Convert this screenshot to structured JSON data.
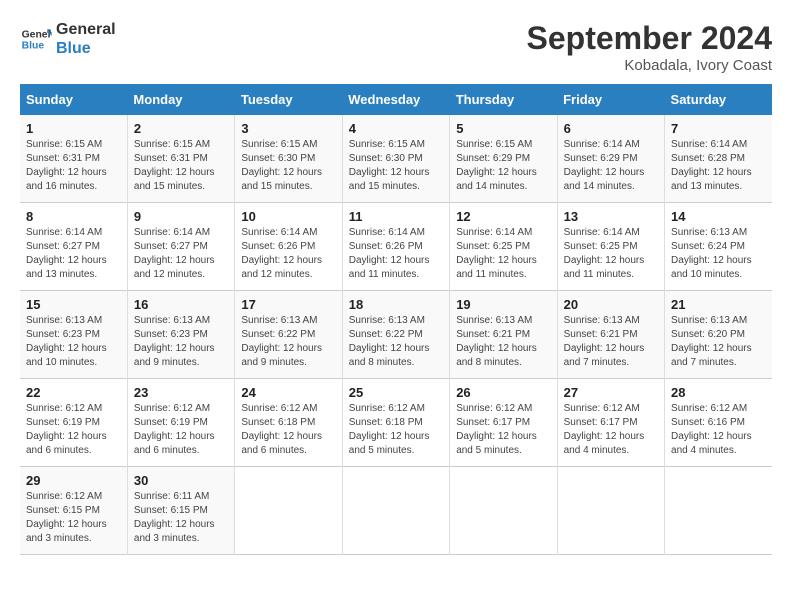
{
  "logo": {
    "line1": "General",
    "line2": "Blue"
  },
  "title": "September 2024",
  "location": "Kobadala, Ivory Coast",
  "days_of_week": [
    "Sunday",
    "Monday",
    "Tuesday",
    "Wednesday",
    "Thursday",
    "Friday",
    "Saturday"
  ],
  "weeks": [
    [
      {
        "day": "1",
        "info": "Sunrise: 6:15 AM\nSunset: 6:31 PM\nDaylight: 12 hours\nand 16 minutes."
      },
      {
        "day": "2",
        "info": "Sunrise: 6:15 AM\nSunset: 6:31 PM\nDaylight: 12 hours\nand 15 minutes."
      },
      {
        "day": "3",
        "info": "Sunrise: 6:15 AM\nSunset: 6:30 PM\nDaylight: 12 hours\nand 15 minutes."
      },
      {
        "day": "4",
        "info": "Sunrise: 6:15 AM\nSunset: 6:30 PM\nDaylight: 12 hours\nand 15 minutes."
      },
      {
        "day": "5",
        "info": "Sunrise: 6:15 AM\nSunset: 6:29 PM\nDaylight: 12 hours\nand 14 minutes."
      },
      {
        "day": "6",
        "info": "Sunrise: 6:14 AM\nSunset: 6:29 PM\nDaylight: 12 hours\nand 14 minutes."
      },
      {
        "day": "7",
        "info": "Sunrise: 6:14 AM\nSunset: 6:28 PM\nDaylight: 12 hours\nand 13 minutes."
      }
    ],
    [
      {
        "day": "8",
        "info": "Sunrise: 6:14 AM\nSunset: 6:27 PM\nDaylight: 12 hours\nand 13 minutes."
      },
      {
        "day": "9",
        "info": "Sunrise: 6:14 AM\nSunset: 6:27 PM\nDaylight: 12 hours\nand 12 minutes."
      },
      {
        "day": "10",
        "info": "Sunrise: 6:14 AM\nSunset: 6:26 PM\nDaylight: 12 hours\nand 12 minutes."
      },
      {
        "day": "11",
        "info": "Sunrise: 6:14 AM\nSunset: 6:26 PM\nDaylight: 12 hours\nand 11 minutes."
      },
      {
        "day": "12",
        "info": "Sunrise: 6:14 AM\nSunset: 6:25 PM\nDaylight: 12 hours\nand 11 minutes."
      },
      {
        "day": "13",
        "info": "Sunrise: 6:14 AM\nSunset: 6:25 PM\nDaylight: 12 hours\nand 11 minutes."
      },
      {
        "day": "14",
        "info": "Sunrise: 6:13 AM\nSunset: 6:24 PM\nDaylight: 12 hours\nand 10 minutes."
      }
    ],
    [
      {
        "day": "15",
        "info": "Sunrise: 6:13 AM\nSunset: 6:23 PM\nDaylight: 12 hours\nand 10 minutes."
      },
      {
        "day": "16",
        "info": "Sunrise: 6:13 AM\nSunset: 6:23 PM\nDaylight: 12 hours\nand 9 minutes."
      },
      {
        "day": "17",
        "info": "Sunrise: 6:13 AM\nSunset: 6:22 PM\nDaylight: 12 hours\nand 9 minutes."
      },
      {
        "day": "18",
        "info": "Sunrise: 6:13 AM\nSunset: 6:22 PM\nDaylight: 12 hours\nand 8 minutes."
      },
      {
        "day": "19",
        "info": "Sunrise: 6:13 AM\nSunset: 6:21 PM\nDaylight: 12 hours\nand 8 minutes."
      },
      {
        "day": "20",
        "info": "Sunrise: 6:13 AM\nSunset: 6:21 PM\nDaylight: 12 hours\nand 7 minutes."
      },
      {
        "day": "21",
        "info": "Sunrise: 6:13 AM\nSunset: 6:20 PM\nDaylight: 12 hours\nand 7 minutes."
      }
    ],
    [
      {
        "day": "22",
        "info": "Sunrise: 6:12 AM\nSunset: 6:19 PM\nDaylight: 12 hours\nand 6 minutes."
      },
      {
        "day": "23",
        "info": "Sunrise: 6:12 AM\nSunset: 6:19 PM\nDaylight: 12 hours\nand 6 minutes."
      },
      {
        "day": "24",
        "info": "Sunrise: 6:12 AM\nSunset: 6:18 PM\nDaylight: 12 hours\nand 6 minutes."
      },
      {
        "day": "25",
        "info": "Sunrise: 6:12 AM\nSunset: 6:18 PM\nDaylight: 12 hours\nand 5 minutes."
      },
      {
        "day": "26",
        "info": "Sunrise: 6:12 AM\nSunset: 6:17 PM\nDaylight: 12 hours\nand 5 minutes."
      },
      {
        "day": "27",
        "info": "Sunrise: 6:12 AM\nSunset: 6:17 PM\nDaylight: 12 hours\nand 4 minutes."
      },
      {
        "day": "28",
        "info": "Sunrise: 6:12 AM\nSunset: 6:16 PM\nDaylight: 12 hours\nand 4 minutes."
      }
    ],
    [
      {
        "day": "29",
        "info": "Sunrise: 6:12 AM\nSunset: 6:15 PM\nDaylight: 12 hours\nand 3 minutes."
      },
      {
        "day": "30",
        "info": "Sunrise: 6:11 AM\nSunset: 6:15 PM\nDaylight: 12 hours\nand 3 minutes."
      },
      {
        "day": "",
        "info": ""
      },
      {
        "day": "",
        "info": ""
      },
      {
        "day": "",
        "info": ""
      },
      {
        "day": "",
        "info": ""
      },
      {
        "day": "",
        "info": ""
      }
    ]
  ]
}
